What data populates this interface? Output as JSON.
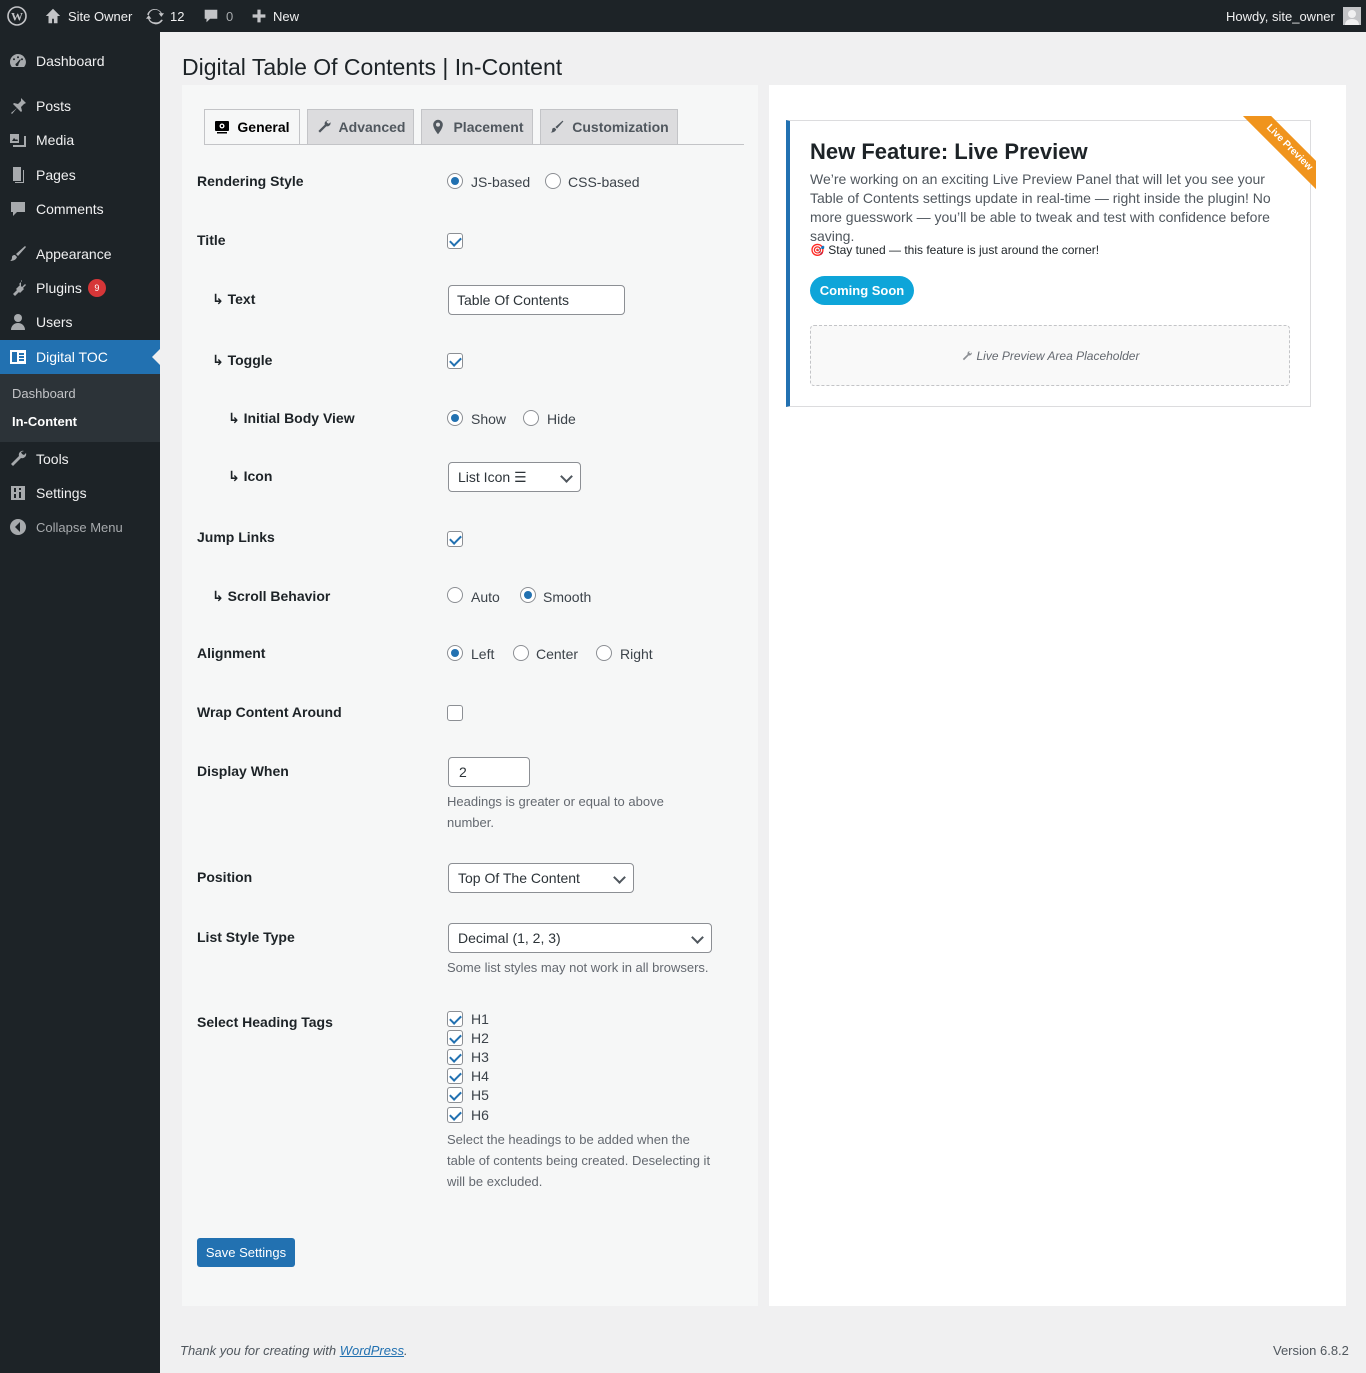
{
  "adminbar": {
    "site_name": "Site Owner",
    "updates_count": "12",
    "comments_count": "0",
    "new_label": "New",
    "howdy": "Howdy, site_owner"
  },
  "sidebar": {
    "items": [
      {
        "label": "Dashboard",
        "icon": "dashboard-icon"
      },
      {
        "label": "Posts",
        "icon": "pin-icon"
      },
      {
        "label": "Media",
        "icon": "media-icon"
      },
      {
        "label": "Pages",
        "icon": "page-icon"
      },
      {
        "label": "Comments",
        "icon": "comment-icon"
      },
      {
        "label": "Appearance",
        "icon": "brush-icon"
      },
      {
        "label": "Plugins",
        "icon": "plugin-icon",
        "badge": "9"
      },
      {
        "label": "Users",
        "icon": "user-icon"
      },
      {
        "label": "Digital TOC",
        "icon": "toc-icon"
      },
      {
        "label": "Tools",
        "icon": "wrench-icon"
      },
      {
        "label": "Settings",
        "icon": "settings-icon"
      },
      {
        "label": "Collapse Menu",
        "icon": "collapse-icon"
      }
    ],
    "submenu": [
      "Dashboard",
      "In-Content"
    ]
  },
  "page_title": "Digital Table Of Contents | In-Content",
  "tabs": [
    "General",
    "Advanced",
    "Placement",
    "Customization"
  ],
  "form": {
    "rendering_style": {
      "label": "Rendering Style",
      "options": [
        "JS-based",
        "CSS-based"
      ],
      "selected": "JS-based"
    },
    "title": {
      "label": "Title",
      "checked": true
    },
    "text": {
      "label": "↳ Text",
      "value": "Table Of Contents"
    },
    "toggle": {
      "label": "↳ Toggle",
      "checked": true
    },
    "initial_body_view": {
      "label": "↳ Initial Body View",
      "options": [
        "Show",
        "Hide"
      ],
      "selected": "Show"
    },
    "icon": {
      "label": "↳ Icon",
      "value": "List Icon ☰"
    },
    "jump_links": {
      "label": "Jump Links",
      "checked": true
    },
    "scroll_behavior": {
      "label": "↳ Scroll Behavior",
      "options": [
        "Auto",
        "Smooth"
      ],
      "selected": "Smooth"
    },
    "alignment": {
      "label": "Alignment",
      "options": [
        "Left",
        "Center",
        "Right"
      ],
      "selected": "Left"
    },
    "wrap_content": {
      "label": "Wrap Content Around",
      "checked": false
    },
    "display_when": {
      "label": "Display When",
      "value": "2",
      "desc_line1": "Headings is greater or equal to above",
      "desc_line2": "number."
    },
    "position": {
      "label": "Position",
      "value": "Top Of The Content"
    },
    "list_style_type": {
      "label": "List Style Type",
      "value": "Decimal (1, 2, 3)",
      "desc": "Some list styles may not work in all browsers."
    },
    "heading_tags": {
      "label": "Select Heading Tags",
      "tags": [
        "H1",
        "H2",
        "H3",
        "H4",
        "H5",
        "H6"
      ],
      "desc_line1": "Select the headings to be added when the",
      "desc_line2": "table of contents being created. Deselecting it",
      "desc_line3": "will be excluded."
    },
    "save_label": "Save Settings"
  },
  "preview_card": {
    "ribbon": "Live Preview",
    "title": "New Feature: Live Preview",
    "body": "We’re working on an exciting Live Preview Panel that will let you see your Table of Contents settings update in real-time — right inside the plugin! No more guesswork — you’ll be able to tweak and test with confidence before saving.",
    "note": "🎯 Stay tuned — this feature is just around the corner!",
    "button": "Coming Soon",
    "placeholder": "Live Preview Area Placeholder"
  },
  "footer": {
    "thanks_prefix": "Thank you for creating with ",
    "link": "WordPress",
    "suffix": ".",
    "version": "Version 6.8.2"
  },
  "colors": {
    "primary": "#2271b1",
    "adminbar": "#1d2327",
    "ribbon": "#f0941d",
    "badge": "#d63638",
    "coming_soon": "#0ea5d9"
  }
}
